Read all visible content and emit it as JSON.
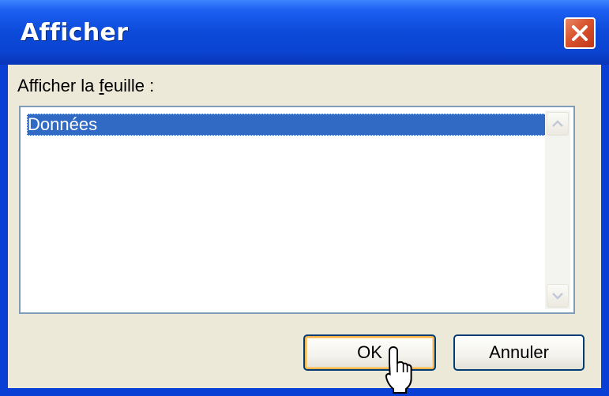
{
  "window": {
    "title": "Afficher",
    "close_icon": "close-x-icon",
    "accent_color": "#0a3fd6",
    "close_color": "#d9532c"
  },
  "dialog": {
    "label_pre": "Afficher la ",
    "label_mnemonic": "f",
    "label_post": "euille :",
    "list": {
      "items": [
        "Données"
      ],
      "selected_index": 0,
      "selection_color": "#316ac5"
    },
    "scrollbar": {
      "up_icon": "scroll-up-arrow-icon",
      "down_icon": "scroll-down-arrow-icon"
    }
  },
  "buttons": {
    "ok_label": "OK",
    "cancel_label": "Annuler"
  },
  "cursor_icon": "mouse-pointer-icon"
}
